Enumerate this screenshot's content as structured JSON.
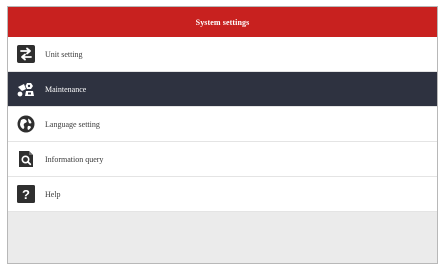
{
  "header": {
    "title": "System settings",
    "color": "#c8211f"
  },
  "menu": {
    "selected_color": "#2e3240",
    "items": [
      {
        "label": "Unit setting",
        "icon": "unit-setting-icon",
        "selected": false
      },
      {
        "label": "Maintenance",
        "icon": "maintenance-icon",
        "selected": true
      },
      {
        "label": "Language setting",
        "icon": "globe-icon",
        "selected": false
      },
      {
        "label": "Information query",
        "icon": "information-query-icon",
        "selected": false
      },
      {
        "label": "Help",
        "icon": "help-icon",
        "selected": false
      }
    ]
  },
  "help_glyph": "?"
}
